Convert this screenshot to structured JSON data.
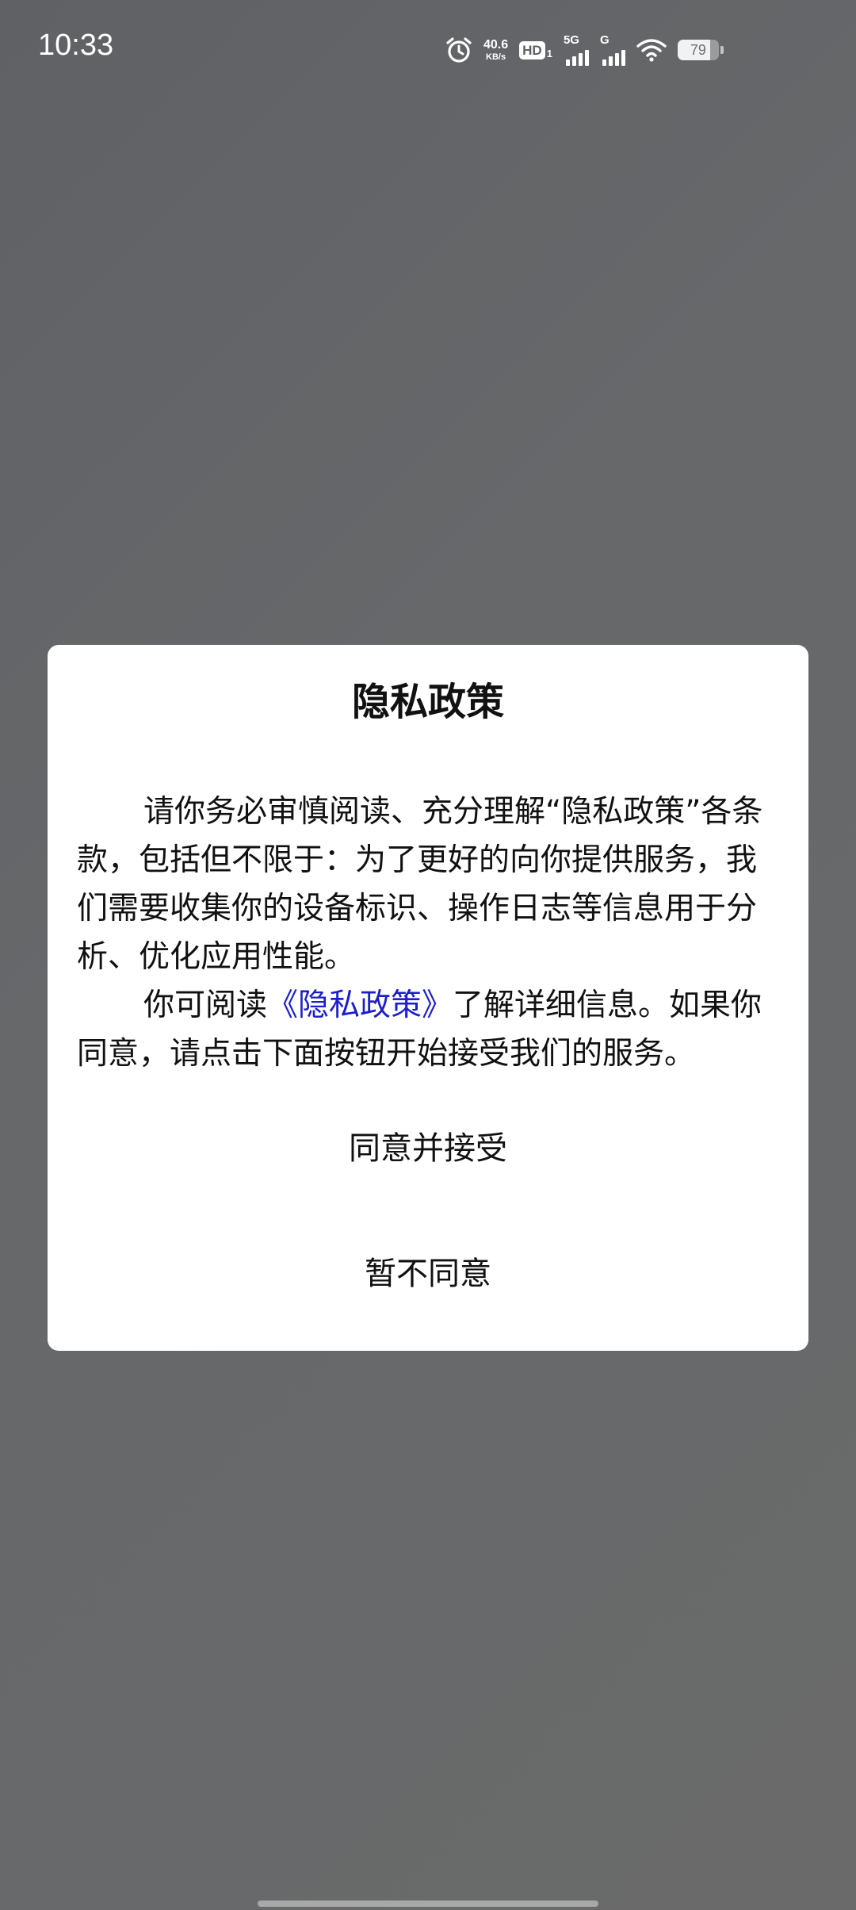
{
  "status_bar": {
    "time": "10:33",
    "net_speed_value": "40.6",
    "net_speed_unit": "KB/s",
    "hd_label": "HD",
    "hd_sub": "1",
    "signal1_label": "5G",
    "signal2_label": "G",
    "battery_level": "79",
    "icons": [
      "alarm-icon",
      "hd-volte-icon",
      "signal-5g-icon",
      "signal-g-icon",
      "wifi-icon",
      "battery-icon"
    ]
  },
  "dialog": {
    "title": "隐私政策",
    "paragraph1": "请你务必审慎阅读、充分理解“隐私政策”各条款，包括但不限于：为了更好的向你提供服务，我们需要收集你的设备标识、操作日志等信息用于分析、优化应用性能。",
    "paragraph2_before": "你可阅读",
    "policy_link": "《隐私政策》",
    "paragraph2_after": "了解详细信息。如果你同意，请点击下面按钮开始接受我们的服务。",
    "agree_button": "同意并接受",
    "disagree_button": "暂不同意"
  },
  "colors": {
    "link": "#1d1fc9",
    "dialog_background": "#ffffff",
    "scrim": "#636466"
  }
}
